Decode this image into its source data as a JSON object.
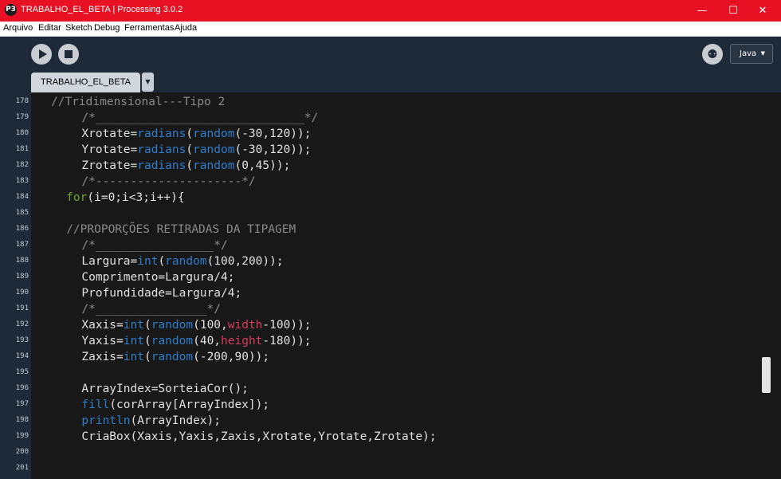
{
  "window": {
    "title": "TRABALHO_EL_BETA | Processing 3.0.2",
    "minimize": "—",
    "maximize": "☐",
    "close": "✕",
    "app_icon_glyph": "P3"
  },
  "menu": [
    "Arquivo",
    "Editar",
    "Sketch",
    "Debug",
    "Ferramentas",
    "Ajuda"
  ],
  "toolbar": {
    "run_icon": "play-icon",
    "stop_icon": "stop-icon",
    "debugger_icon": "debugger-butterfly-icon",
    "debugger_glyph": "⚉",
    "mode_label": "Java",
    "mode_arrow": "▼"
  },
  "tabs": [
    {
      "label": "TRABALHO_EL_BETA"
    }
  ],
  "tab_menu_arrow": "▼",
  "colors": {
    "comment": "#8a8a8a",
    "function": "#2f7cc8",
    "keyword": "#6ea52c",
    "constant": "#d73c63",
    "default": "#e0e0e0"
  },
  "code_lines": [
    {
      "num": "178",
      "indent": 0,
      "tokens": [
        {
          "t": "//Tridimensional---Tipo 2",
          "c": "comment"
        }
      ]
    },
    {
      "num": "179",
      "indent": 4,
      "tokens": [
        {
          "t": "/*______________________________*/",
          "c": "comment"
        }
      ]
    },
    {
      "num": "180",
      "indent": 4,
      "tokens": [
        {
          "t": "Xrotate=",
          "c": "default"
        },
        {
          "t": "radians",
          "c": "function"
        },
        {
          "t": "(",
          "c": "default"
        },
        {
          "t": "random",
          "c": "function"
        },
        {
          "t": "(-30,120));",
          "c": "default"
        }
      ]
    },
    {
      "num": "181",
      "indent": 4,
      "tokens": [
        {
          "t": "Yrotate=",
          "c": "default"
        },
        {
          "t": "radians",
          "c": "function"
        },
        {
          "t": "(",
          "c": "default"
        },
        {
          "t": "random",
          "c": "function"
        },
        {
          "t": "(-30,120));",
          "c": "default"
        }
      ]
    },
    {
      "num": "182",
      "indent": 4,
      "tokens": [
        {
          "t": "Zrotate=",
          "c": "default"
        },
        {
          "t": "radians",
          "c": "function"
        },
        {
          "t": "(",
          "c": "default"
        },
        {
          "t": "random",
          "c": "function"
        },
        {
          "t": "(0,45));",
          "c": "default"
        }
      ]
    },
    {
      "num": "183",
      "indent": 4,
      "tokens": [
        {
          "t": "/*---------------------*/",
          "c": "comment"
        }
      ]
    },
    {
      "num": "184",
      "indent": 2,
      "tokens": [
        {
          "t": "for",
          "c": "keyword"
        },
        {
          "t": "(i=0;i<3;i++){",
          "c": "default"
        }
      ]
    },
    {
      "num": "185",
      "indent": 0,
      "tokens": []
    },
    {
      "num": "186",
      "indent": 2,
      "tokens": [
        {
          "t": "//PROPORÇÕES RETIRADAS DA TIPAGEM",
          "c": "comment"
        }
      ]
    },
    {
      "num": "187",
      "indent": 4,
      "tokens": [
        {
          "t": "/*_________________*/",
          "c": "comment"
        }
      ]
    },
    {
      "num": "188",
      "indent": 4,
      "tokens": [
        {
          "t": "Largura=",
          "c": "default"
        },
        {
          "t": "int",
          "c": "function"
        },
        {
          "t": "(",
          "c": "default"
        },
        {
          "t": "random",
          "c": "function"
        },
        {
          "t": "(100,200));",
          "c": "default"
        }
      ]
    },
    {
      "num": "189",
      "indent": 4,
      "tokens": [
        {
          "t": "Comprimento=Largura/4;",
          "c": "default"
        }
      ]
    },
    {
      "num": "190",
      "indent": 4,
      "tokens": [
        {
          "t": "Profundidade=Largura/4;",
          "c": "default"
        }
      ]
    },
    {
      "num": "191",
      "indent": 4,
      "tokens": [
        {
          "t": "/*________________*/",
          "c": "comment"
        }
      ]
    },
    {
      "num": "192",
      "indent": 4,
      "tokens": [
        {
          "t": "Xaxis=",
          "c": "default"
        },
        {
          "t": "int",
          "c": "function"
        },
        {
          "t": "(",
          "c": "default"
        },
        {
          "t": "random",
          "c": "function"
        },
        {
          "t": "(100,",
          "c": "default"
        },
        {
          "t": "width",
          "c": "constant"
        },
        {
          "t": "-100));",
          "c": "default"
        }
      ]
    },
    {
      "num": "193",
      "indent": 4,
      "tokens": [
        {
          "t": "Yaxis=",
          "c": "default"
        },
        {
          "t": "int",
          "c": "function"
        },
        {
          "t": "(",
          "c": "default"
        },
        {
          "t": "random",
          "c": "function"
        },
        {
          "t": "(40,",
          "c": "default"
        },
        {
          "t": "height",
          "c": "constant"
        },
        {
          "t": "-180));",
          "c": "default"
        }
      ]
    },
    {
      "num": "194",
      "indent": 4,
      "tokens": [
        {
          "t": "Zaxis=",
          "c": "default"
        },
        {
          "t": "int",
          "c": "function"
        },
        {
          "t": "(",
          "c": "default"
        },
        {
          "t": "random",
          "c": "function"
        },
        {
          "t": "(-200,90));",
          "c": "default"
        }
      ]
    },
    {
      "num": "195",
      "indent": 0,
      "tokens": []
    },
    {
      "num": "196",
      "indent": 4,
      "tokens": [
        {
          "t": "ArrayIndex=SorteiaCor();",
          "c": "default"
        }
      ]
    },
    {
      "num": "197",
      "indent": 4,
      "tokens": [
        {
          "t": "fill",
          "c": "function"
        },
        {
          "t": "(corArray[ArrayIndex]);",
          "c": "default"
        }
      ]
    },
    {
      "num": "198",
      "indent": 4,
      "tokens": [
        {
          "t": "println",
          "c": "function"
        },
        {
          "t": "(ArrayIndex);",
          "c": "default"
        }
      ]
    },
    {
      "num": "199",
      "indent": 4,
      "tokens": [
        {
          "t": "CriaBox(Xaxis,Yaxis,Zaxis,Xrotate,Yrotate,Zrotate);",
          "c": "default"
        }
      ]
    },
    {
      "num": "200",
      "indent": 0,
      "tokens": []
    },
    {
      "num": "201",
      "indent": 0,
      "tokens": []
    }
  ]
}
